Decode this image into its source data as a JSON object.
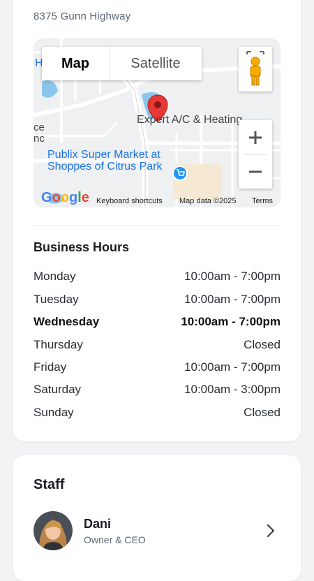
{
  "address": "8375 Gunn Highway",
  "map": {
    "toggle_map": "Map",
    "toggle_satellite": "Satellite",
    "place_label": "Expert A/C & Heating",
    "poi_label_line1": "Publix Super Market at",
    "poi_label_line2": "Shoppes of Citrus Park",
    "edge_label_1": "ce",
    "edge_label_2": "nc",
    "google_logo": "Google",
    "keyboard_shortcuts": "Keyboard shortcuts",
    "map_data": "Map data ©2025",
    "terms": "Terms",
    "pin_color": "#e53935"
  },
  "hours": {
    "title": "Business Hours",
    "rows": [
      {
        "day": "Monday",
        "time": "10:00am - 7:00pm"
      },
      {
        "day": "Tuesday",
        "time": "10:00am - 7:00pm"
      },
      {
        "day": "Wednesday",
        "time": "10:00am - 7:00pm"
      },
      {
        "day": "Thursday",
        "time": "Closed"
      },
      {
        "day": "Friday",
        "time": "10:00am - 7:00pm"
      },
      {
        "day": "Saturday",
        "time": "10:00am - 3:00pm"
      },
      {
        "day": "Sunday",
        "time": "Closed"
      }
    ]
  },
  "staff": {
    "title": "Staff",
    "members": [
      {
        "name": "Dani",
        "role": "Owner & CEO"
      }
    ]
  }
}
